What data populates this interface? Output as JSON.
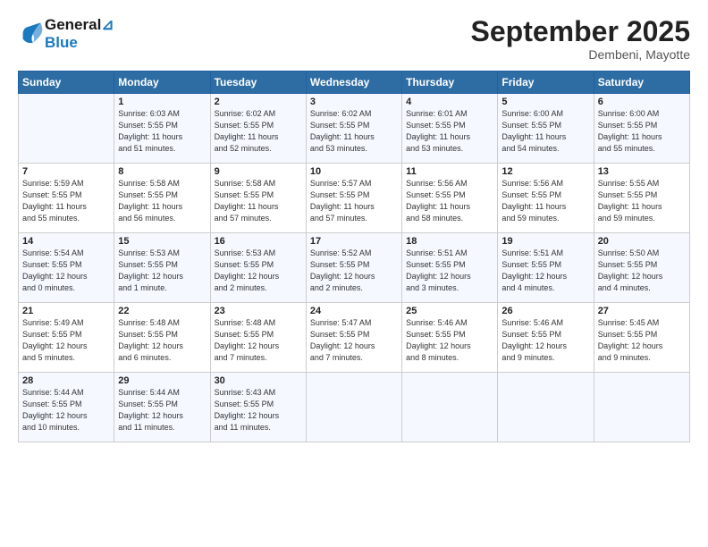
{
  "header": {
    "logo_line1": "General",
    "logo_line2": "Blue",
    "month": "September 2025",
    "location": "Dembeni, Mayotte"
  },
  "days_of_week": [
    "Sunday",
    "Monday",
    "Tuesday",
    "Wednesday",
    "Thursday",
    "Friday",
    "Saturday"
  ],
  "weeks": [
    [
      {
        "day": "",
        "info": ""
      },
      {
        "day": "1",
        "info": "Sunrise: 6:03 AM\nSunset: 5:55 PM\nDaylight: 11 hours\nand 51 minutes."
      },
      {
        "day": "2",
        "info": "Sunrise: 6:02 AM\nSunset: 5:55 PM\nDaylight: 11 hours\nand 52 minutes."
      },
      {
        "day": "3",
        "info": "Sunrise: 6:02 AM\nSunset: 5:55 PM\nDaylight: 11 hours\nand 53 minutes."
      },
      {
        "day": "4",
        "info": "Sunrise: 6:01 AM\nSunset: 5:55 PM\nDaylight: 11 hours\nand 53 minutes."
      },
      {
        "day": "5",
        "info": "Sunrise: 6:00 AM\nSunset: 5:55 PM\nDaylight: 11 hours\nand 54 minutes."
      },
      {
        "day": "6",
        "info": "Sunrise: 6:00 AM\nSunset: 5:55 PM\nDaylight: 11 hours\nand 55 minutes."
      }
    ],
    [
      {
        "day": "7",
        "info": "Sunrise: 5:59 AM\nSunset: 5:55 PM\nDaylight: 11 hours\nand 55 minutes."
      },
      {
        "day": "8",
        "info": "Sunrise: 5:58 AM\nSunset: 5:55 PM\nDaylight: 11 hours\nand 56 minutes."
      },
      {
        "day": "9",
        "info": "Sunrise: 5:58 AM\nSunset: 5:55 PM\nDaylight: 11 hours\nand 57 minutes."
      },
      {
        "day": "10",
        "info": "Sunrise: 5:57 AM\nSunset: 5:55 PM\nDaylight: 11 hours\nand 57 minutes."
      },
      {
        "day": "11",
        "info": "Sunrise: 5:56 AM\nSunset: 5:55 PM\nDaylight: 11 hours\nand 58 minutes."
      },
      {
        "day": "12",
        "info": "Sunrise: 5:56 AM\nSunset: 5:55 PM\nDaylight: 11 hours\nand 59 minutes."
      },
      {
        "day": "13",
        "info": "Sunrise: 5:55 AM\nSunset: 5:55 PM\nDaylight: 11 hours\nand 59 minutes."
      }
    ],
    [
      {
        "day": "14",
        "info": "Sunrise: 5:54 AM\nSunset: 5:55 PM\nDaylight: 12 hours\nand 0 minutes."
      },
      {
        "day": "15",
        "info": "Sunrise: 5:53 AM\nSunset: 5:55 PM\nDaylight: 12 hours\nand 1 minute."
      },
      {
        "day": "16",
        "info": "Sunrise: 5:53 AM\nSunset: 5:55 PM\nDaylight: 12 hours\nand 2 minutes."
      },
      {
        "day": "17",
        "info": "Sunrise: 5:52 AM\nSunset: 5:55 PM\nDaylight: 12 hours\nand 2 minutes."
      },
      {
        "day": "18",
        "info": "Sunrise: 5:51 AM\nSunset: 5:55 PM\nDaylight: 12 hours\nand 3 minutes."
      },
      {
        "day": "19",
        "info": "Sunrise: 5:51 AM\nSunset: 5:55 PM\nDaylight: 12 hours\nand 4 minutes."
      },
      {
        "day": "20",
        "info": "Sunrise: 5:50 AM\nSunset: 5:55 PM\nDaylight: 12 hours\nand 4 minutes."
      }
    ],
    [
      {
        "day": "21",
        "info": "Sunrise: 5:49 AM\nSunset: 5:55 PM\nDaylight: 12 hours\nand 5 minutes."
      },
      {
        "day": "22",
        "info": "Sunrise: 5:48 AM\nSunset: 5:55 PM\nDaylight: 12 hours\nand 6 minutes."
      },
      {
        "day": "23",
        "info": "Sunrise: 5:48 AM\nSunset: 5:55 PM\nDaylight: 12 hours\nand 7 minutes."
      },
      {
        "day": "24",
        "info": "Sunrise: 5:47 AM\nSunset: 5:55 PM\nDaylight: 12 hours\nand 7 minutes."
      },
      {
        "day": "25",
        "info": "Sunrise: 5:46 AM\nSunset: 5:55 PM\nDaylight: 12 hours\nand 8 minutes."
      },
      {
        "day": "26",
        "info": "Sunrise: 5:46 AM\nSunset: 5:55 PM\nDaylight: 12 hours\nand 9 minutes."
      },
      {
        "day": "27",
        "info": "Sunrise: 5:45 AM\nSunset: 5:55 PM\nDaylight: 12 hours\nand 9 minutes."
      }
    ],
    [
      {
        "day": "28",
        "info": "Sunrise: 5:44 AM\nSunset: 5:55 PM\nDaylight: 12 hours\nand 10 minutes."
      },
      {
        "day": "29",
        "info": "Sunrise: 5:44 AM\nSunset: 5:55 PM\nDaylight: 12 hours\nand 11 minutes."
      },
      {
        "day": "30",
        "info": "Sunrise: 5:43 AM\nSunset: 5:55 PM\nDaylight: 12 hours\nand 11 minutes."
      },
      {
        "day": "",
        "info": ""
      },
      {
        "day": "",
        "info": ""
      },
      {
        "day": "",
        "info": ""
      },
      {
        "day": "",
        "info": ""
      }
    ]
  ]
}
